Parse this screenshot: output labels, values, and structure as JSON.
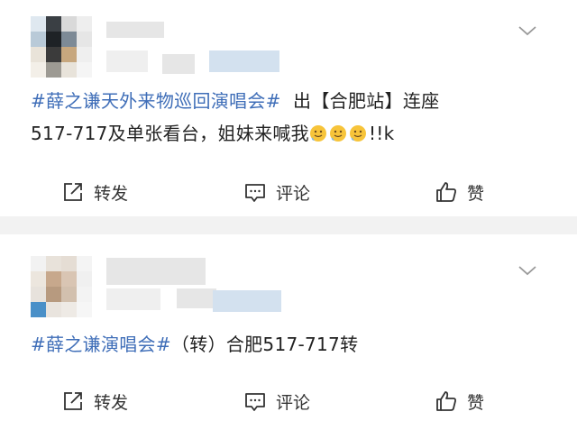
{
  "posts": [
    {
      "content": {
        "hashtag": "#薛之谦天外来物巡回演唱会#",
        "line1_rest": "出【合肥站】连座",
        "line2_text": "517-717及单张看台，姐妹来喊我",
        "line2_suffix": "!!k"
      },
      "actions": {
        "repost": "转发",
        "comment": "评论",
        "like": "赞"
      }
    },
    {
      "content": {
        "hashtag": "#薛之谦演唱会#",
        "line1_rest": "（转）合肥517-717转"
      },
      "actions": {
        "repost": "转发",
        "comment": "评论",
        "like": "赞"
      }
    }
  ],
  "icons": {
    "more": "chevron-down-icon",
    "repost": "share-icon",
    "comment": "comment-icon",
    "like": "thumbs-up-icon",
    "emoji": "smiling-face-emoji"
  },
  "colors": {
    "hashtag": "#3f6eb8",
    "text": "#222222",
    "divider": "#f2f2f2"
  }
}
